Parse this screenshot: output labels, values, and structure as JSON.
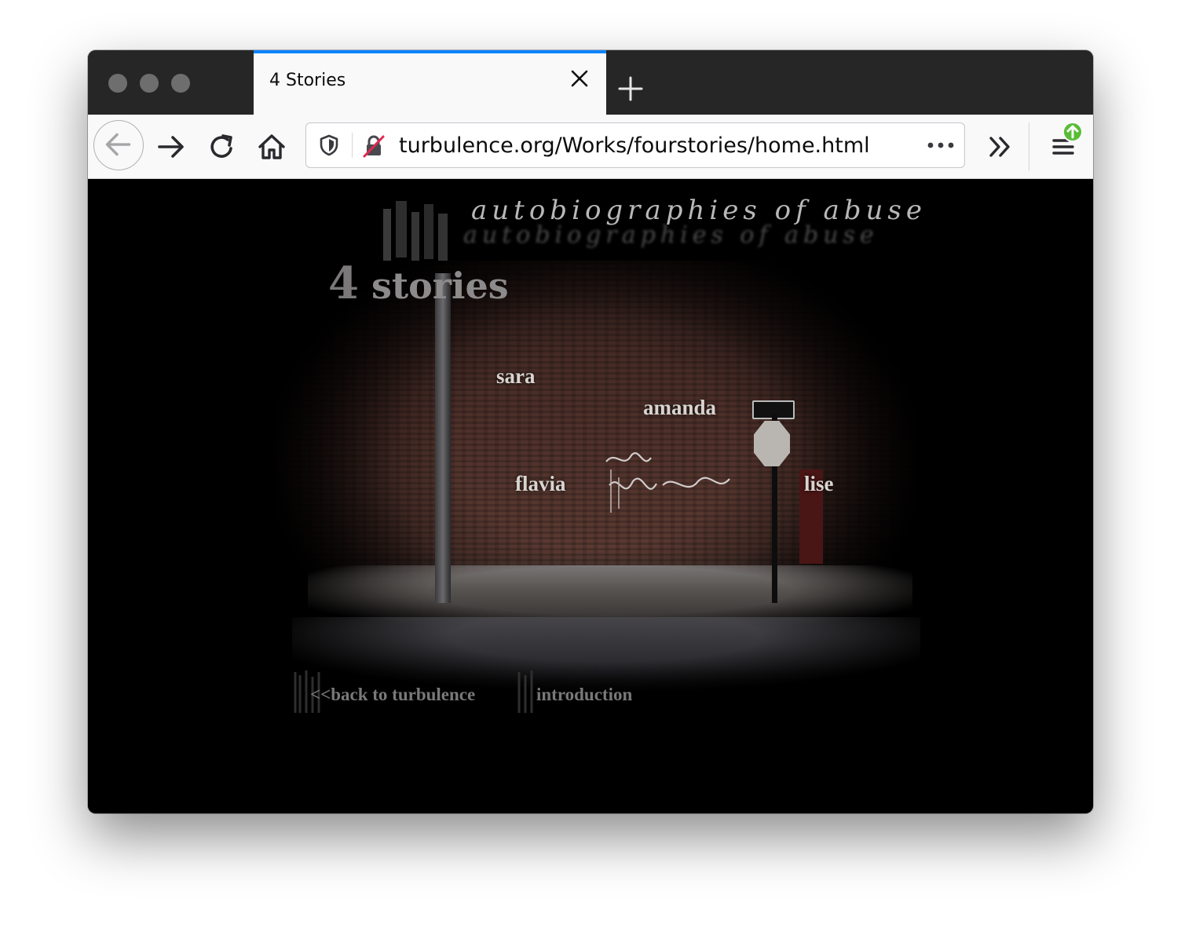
{
  "browser": {
    "tab": {
      "title": "4 Stories"
    },
    "url": "turbulence.org/Works/fourstories/home.html",
    "icons": [
      "close-icon",
      "plus-icon",
      "back-arrow-icon",
      "forward-arrow-icon",
      "reload-icon",
      "home-icon",
      "shield-icon",
      "insecure-lock-icon",
      "more-dots-icon",
      "overflow-chevrons-icon",
      "menu-icon",
      "update-badge-icon"
    ],
    "colors": {
      "tab_accent": "#0a84ff",
      "titlebar": "#262626",
      "toolbar": "#f9f9fa",
      "update_badge": "#57bd35"
    }
  },
  "page": {
    "header_script": "autobiographies of abuse",
    "title_number": "4",
    "title_word": "stories",
    "stories": [
      "sara",
      "amanda",
      "flavia",
      "lise"
    ],
    "nav": {
      "back": "<<back to turbulence",
      "intro": "introduction"
    }
  }
}
